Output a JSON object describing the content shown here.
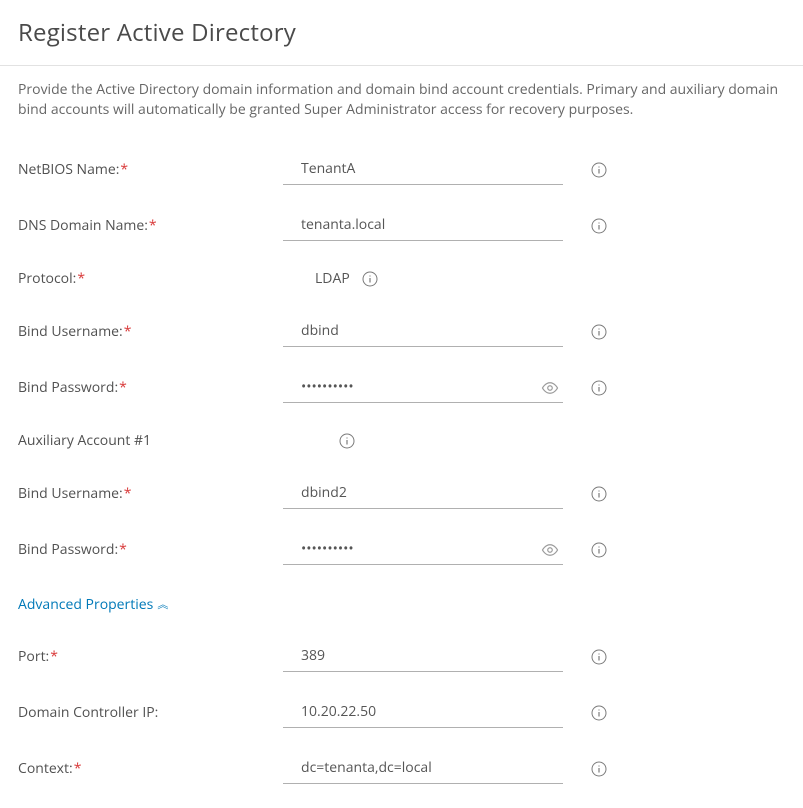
{
  "title": "Register Active Directory",
  "description": "Provide the Active Directory domain information and domain bind account credentials. Primary and auxiliary domain bind accounts will automatically be granted Super Administrator access for recovery purposes.",
  "labels": {
    "netbios": "NetBIOS Name:",
    "dns": "DNS Domain Name:",
    "protocol": "Protocol:",
    "bind_user_1": "Bind Username:",
    "bind_pass_1": "Bind Password:",
    "aux_account": "Auxiliary Account #1",
    "bind_user_2": "Bind Username:",
    "bind_pass_2": "Bind Password:",
    "port": "Port:",
    "dc_ip": "Domain Controller IP:",
    "context": "Context:"
  },
  "values": {
    "netbios": "TenantA",
    "dns": "tenanta.local",
    "protocol": "LDAP",
    "bind_user_1": "dbind",
    "bind_pass_1": "••••••••••",
    "bind_user_2": "dbind2",
    "bind_pass_2": "••••••••••",
    "port": "389",
    "dc_ip": "10.20.22.50",
    "context": "dc=tenanta,dc=local"
  },
  "advanced_toggle": "Advanced Properties",
  "required_marker": "*"
}
